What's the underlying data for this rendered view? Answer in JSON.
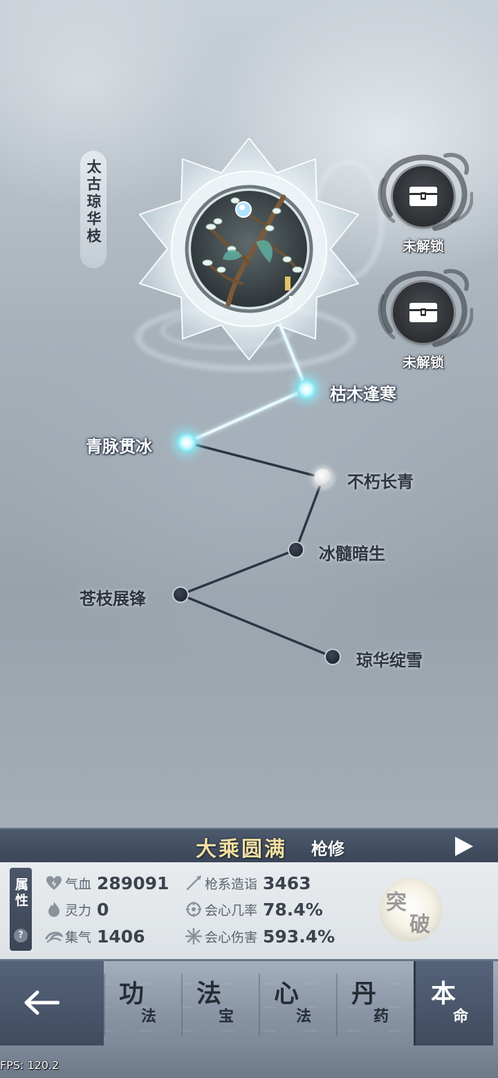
{
  "artifact": {
    "name": "太古琼华枝"
  },
  "locked_slots": [
    {
      "label": "未解锁",
      "icon": "lock-chest-icon"
    },
    {
      "label": "未解锁",
      "icon": "lock-chest-icon"
    }
  ],
  "skill_nodes": [
    {
      "label": "枯木逢寒",
      "state": "lit"
    },
    {
      "label": "青脉贯冰",
      "state": "lit"
    },
    {
      "label": "不朽长青",
      "state": "next"
    },
    {
      "label": "冰髓暗生",
      "state": "locked"
    },
    {
      "label": "苍枝展锋",
      "state": "locked"
    },
    {
      "label": "琼华绽雪",
      "state": "locked"
    }
  ],
  "realm": {
    "name": "大乘圆满",
    "class": "枪修"
  },
  "attributes": {
    "tab_label": "属性",
    "help": "?",
    "stats": [
      {
        "label": "气血",
        "value": "289091",
        "icon": "heart-icon"
      },
      {
        "label": "灵力",
        "value": "0",
        "icon": "flame-icon"
      },
      {
        "label": "集气",
        "value": "1406",
        "icon": "wind-icon"
      },
      {
        "label": "枪系造诣",
        "value": "3463",
        "icon": "spear-icon"
      },
      {
        "label": "会心几率",
        "value": "78.4%",
        "icon": "crit-chance-icon"
      },
      {
        "label": "会心伤害",
        "value": "593.4%",
        "icon": "crit-damage-icon"
      }
    ],
    "breakthrough": {
      "char1": "突",
      "char2": "破"
    }
  },
  "nav": {
    "tabs": [
      {
        "big": "功",
        "small": "法",
        "active": false
      },
      {
        "big": "法",
        "small": "宝",
        "active": false
      },
      {
        "big": "心",
        "small": "法",
        "active": false
      },
      {
        "big": "丹",
        "small": "药",
        "active": false
      },
      {
        "big": "本",
        "small": "命",
        "active": true
      }
    ]
  },
  "fps": "FPS: 120.2",
  "colors": {
    "realm_gold": "#f3dfa3",
    "lit_node": "#7fe6f5",
    "panel_dark": "#3f4b5e"
  }
}
